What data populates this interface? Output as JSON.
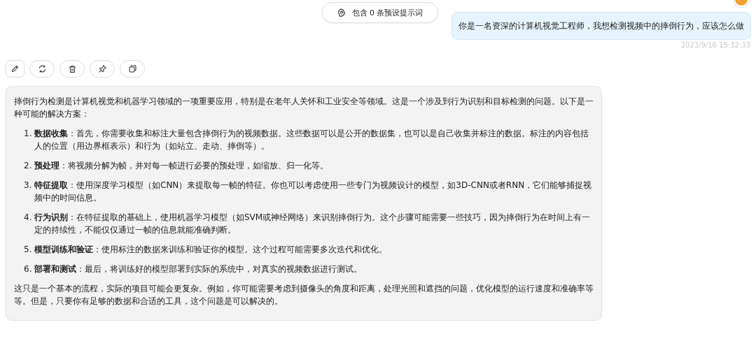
{
  "prompt_badge": {
    "label": "包含 0 条预设提示词"
  },
  "user_message": {
    "text": "你是一名资深的计算机视觉工程师，我想检测视频中的摔倒行为，应该怎么做",
    "time": "2023/9/16 15:32:33"
  },
  "actions": [
    {
      "kind": "edit"
    },
    {
      "kind": "refresh"
    },
    {
      "kind": "delete"
    },
    {
      "kind": "pin"
    },
    {
      "kind": "copy"
    }
  ],
  "response": {
    "intro": "摔倒行为检测是计算机视觉和机器学习领域的一项重要应用，特别是在老年人关怀和工业安全等领域。这是一个涉及到行为识别和目标检测的问题。以下是一种可能的解决方案：",
    "steps": [
      {
        "number": "1.",
        "text": "**数据收集**：首先，你需要收集和标注大量包含摔倒行为的视频数据。这些数据可以是公开的数据集，也可以是自己收集并标注的数据。标注的内容包括人的位置（用边界框表示）和行为（如站立、走动、摔倒等）。"
      },
      {
        "number": "2.",
        "text": "**预处理**：将视频分解为帧，并对每一帧进行必要的预处理，如缩放、归一化等。"
      },
      {
        "number": "3.",
        "text": "**特征提取**：使用深度学习模型（如CNN）来提取每一帧的特征。你也可以考虑使用一些专门为视频设计的模型，如3D-CNN或者RNN，它们能够捕捉视频中的时间信息。"
      },
      {
        "number": "4.",
        "text": "**行为识别**：在特征提取的基础上，使用机器学习模型（如SVM或神经网络）来识别摔倒行为。这个步骤可能需要一些技巧，因为摔倒行为在时间上有一定的持续性，不能仅仅通过一帧的信息就能准确判断。"
      },
      {
        "number": "5.",
        "text": "**模型训练和验证**：使用标注的数据来训练和验证你的模型。这个过程可能需要多次迭代和优化。"
      },
      {
        "number": "6.",
        "text": "**部署和测试**：最后，将训练好的模型部署到实际的系统中，对真实的视频数据进行测试。"
      }
    ],
    "outro": "这只是一个基本的流程，实际的项目可能会更复杂。例如，你可能需要考虑到摄像头的角度和距离，处理光照和遮挡的问题，优化模型的运行速度和准确率等等。但是，只要你有足够的数据和合适的工具，这个问题是可以解决的。"
  }
}
